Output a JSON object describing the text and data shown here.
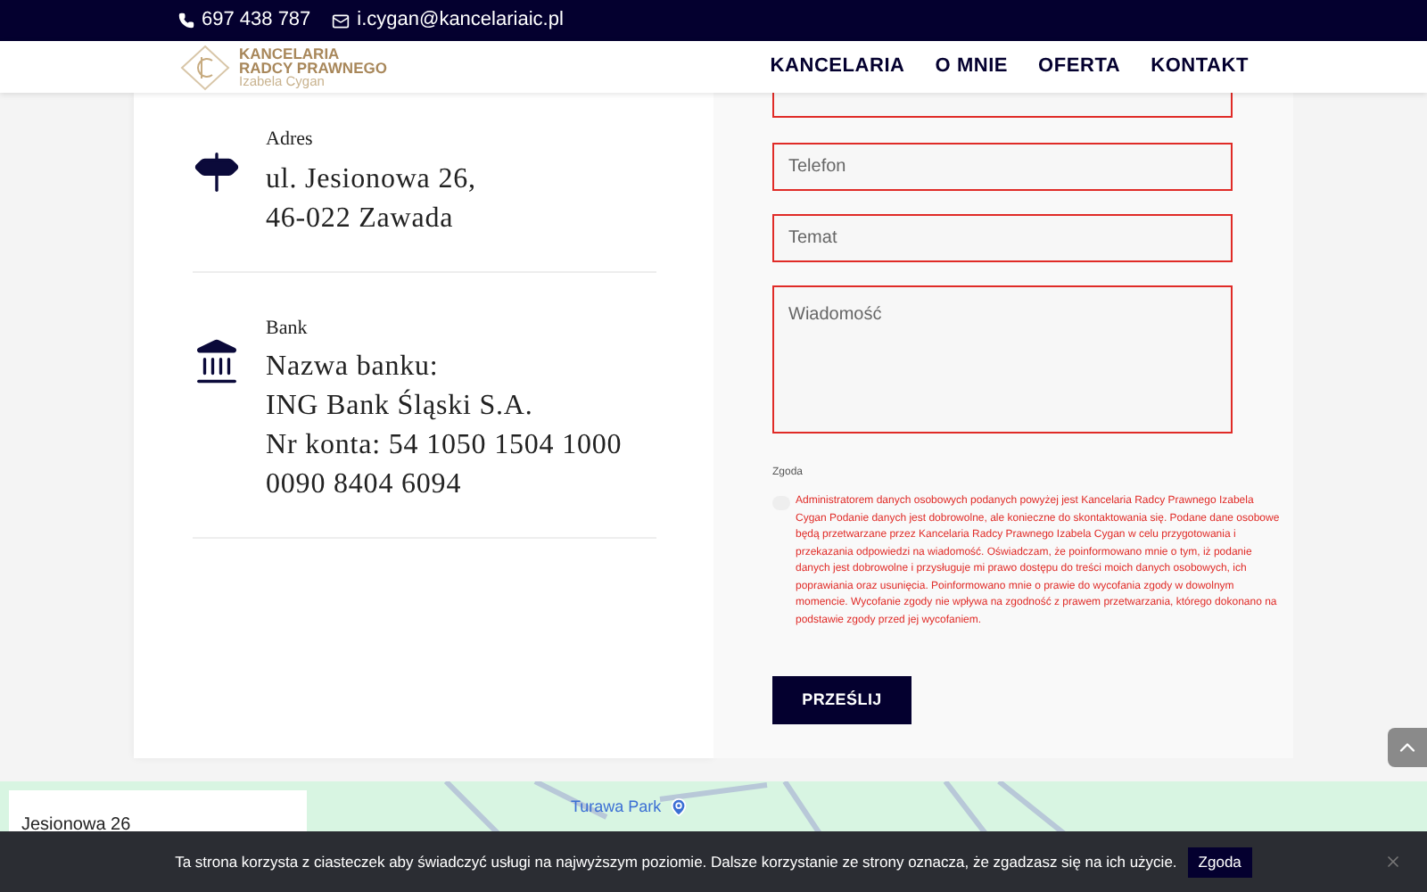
{
  "top_bar": {
    "phone": "697 438 787",
    "email": "i.cygan@kancelariaic.pl"
  },
  "logo": {
    "line1": "KANCELARIA",
    "line2": "RADCY PRAWNEGO",
    "line3": "Izabela Cygan"
  },
  "nav": [
    "KANCELARIA",
    "O MNIE",
    "OFERTA",
    "KONTAKT"
  ],
  "contact_items": [
    {
      "kind": "address",
      "label": "Adres",
      "lines": [
        "ul. Jesionowa 26,",
        "46-022 Zawada"
      ]
    },
    {
      "kind": "bank",
      "label": "Bank",
      "lines": [
        "Nazwa banku:",
        "ING Bank Śląski S.A.",
        "Nr konta: 54 1050 1504 1000",
        "0090 8404 6094"
      ]
    }
  ],
  "form": {
    "fields": [
      {
        "kind": "input",
        "placeholder": "Telefon",
        "error": true
      },
      {
        "kind": "input",
        "placeholder": "Temat",
        "error": true
      },
      {
        "kind": "textarea",
        "placeholder": "Wiadomość",
        "error": true
      }
    ],
    "consent": {
      "label": "Zgoda",
      "checked": false,
      "error": true,
      "text": "Administratorem danych osobowych podanych powyżej jest Kancelaria Radcy Prawnego Izabela Cygan Podanie danych jest dobrowolne, ale konieczne do skontaktowania się. Podane dane osobowe będą przetwarzane przez Kancelaria Radcy Prawnego Izabela Cygan w celu przygotowania i przekazania odpowiedzi na wiadomość. Oświadczam, że poinformowano mnie o tym, iż podanie danych jest dobrowolne i przysługuje mi prawo dostępu do treści moich danych osobowych, ich poprawiania oraz usunięcia. Poinformowano mnie o prawie do wycofania zgody w dowolnym momencie. Wycofanie zgody nie wpływa na zgodność z prawem przetwarzania, którego dokonano na podstawie zgody przed jej wycofaniem."
    },
    "submit": "PRZEŚLIJ"
  },
  "map": {
    "place_card": "Jesionowa 26",
    "poi": "Turawa Park"
  },
  "cookie_banner": {
    "text": "Ta strona korzysta z ciasteczek aby świadczyć usługi na najwyższym poziomie. Dalsze korzystanie ze strony oznacza, że zgadzasz się na ich użycie.",
    "button": "Zgoda"
  }
}
